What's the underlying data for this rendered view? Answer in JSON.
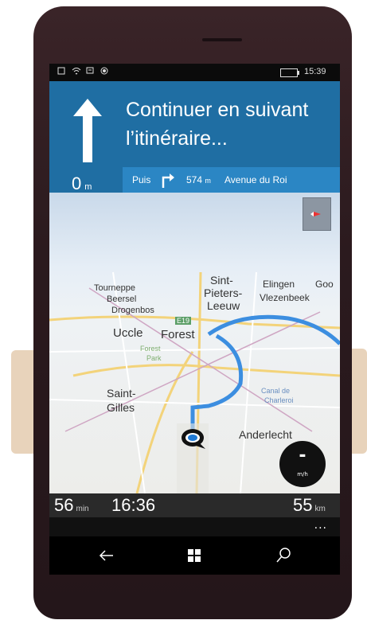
{
  "status": {
    "time": "15:39"
  },
  "navigation": {
    "instruction": "Continuer en suivant l’itinéraire...",
    "current_distance": "0",
    "current_unit": "m",
    "next_prefix": "Puis",
    "next_distance": "574",
    "next_unit": "m",
    "next_street": "Avenue du Roi"
  },
  "map_labels": {
    "tournepe": "Tourneppe",
    "beersel": "Beersel",
    "drogenbos": "Drogenbos",
    "uccle": "Uccle",
    "forest": "Forest",
    "sint1": "Sint-",
    "sint2": "Pieters-",
    "sint3": "Leeuw",
    "elingen": "Elingen",
    "vlez": "Vlezenbeek",
    "goo": "Goo",
    "saint1": "Saint-",
    "saint2": "Gilles",
    "anderlecht": "Anderlecht",
    "road": "E19",
    "forest_park1": "Forest",
    "forest_park2": "Park",
    "canal1": "Canal de",
    "canal2": "Charleroi"
  },
  "speed": {
    "value": "-",
    "unit": "m/h"
  },
  "trip": {
    "remaining_time": "56",
    "remaining_time_unit": "min",
    "arrival": "16:36",
    "remaining_distance": "55",
    "remaining_distance_unit": "km"
  },
  "more_label": "...",
  "colors": {
    "header": "#1f6ea3",
    "next_bar": "#2b86c4",
    "route": "#3c8ee0"
  },
  "icons": [
    "back-icon",
    "windows-icon",
    "search-icon",
    "compass-icon",
    "turn-right-icon",
    "arrow-up-icon"
  ]
}
